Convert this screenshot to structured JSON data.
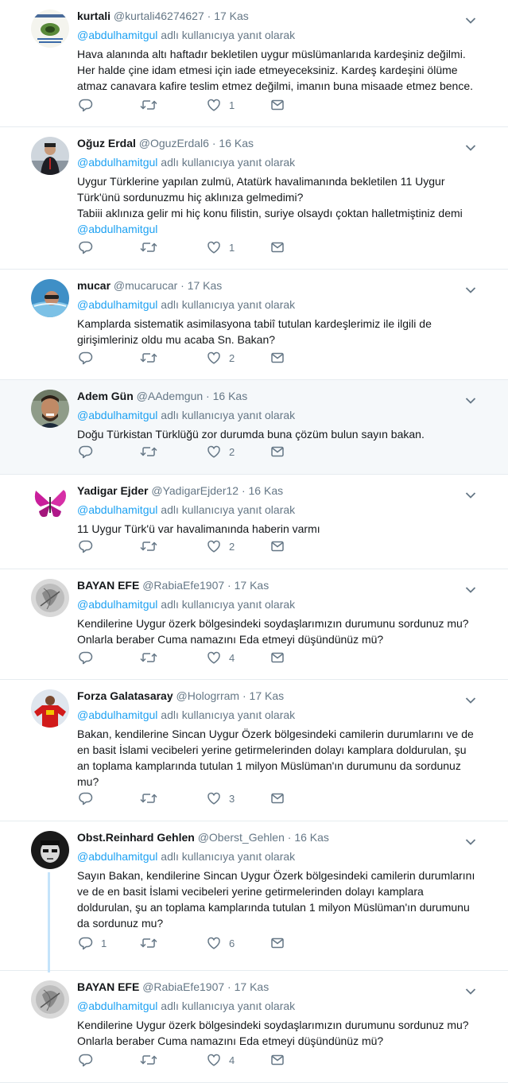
{
  "reply_label": "adlı kullanıcıya yanıt olarak",
  "tweets": [
    {
      "name": "kurtali",
      "handle": "@kurtali46274627",
      "time": "17 Kas",
      "reply_to": "@abdulhamitgul",
      "text": "Hava alanında altı haftadır bekletilen uygur müslümanlarıda kardeşiniz değilmi. Her halde çine idam etmesi için iade etmeyeceksiniz. Kardeş kardeşini ölüme atmaz canavara kafire teslim etmez değilmi, imanın buna misaade etmez bence.",
      "text_mention": "",
      "replies": "",
      "retweets": "",
      "likes": "1"
    },
    {
      "name": "Oğuz Erdal",
      "handle": "@OguzErdal6",
      "time": "16 Kas",
      "reply_to": "@abdulhamitgul",
      "text": "Uygur Türklerine yapılan zulmü, Atatürk havalimanında bekletilen 11 Uygur Türk'ünü sordunuzmu hiç aklınıza gelmedimi?\nTabiii aklınıza gelir mi hiç konu filistin, suriye olsaydı çoktan halletmiştiniz demi",
      "text_mention": "@abdulhamitgul",
      "replies": "",
      "retweets": "",
      "likes": "1"
    },
    {
      "name": "mucar",
      "handle": "@mucarucar",
      "time": "17 Kas",
      "reply_to": "@abdulhamitgul",
      "text": "Kamplarda sistematik asimilasyona tabiî tutulan kardeşlerimiz ile ilgili de girişimleriniz oldu mu acaba Sn. Bakan?",
      "text_mention": "",
      "replies": "",
      "retweets": "",
      "likes": "2"
    },
    {
      "name": "Adem Gün",
      "handle": "@AAdemgun",
      "time": "16 Kas",
      "reply_to": "@abdulhamitgul",
      "text": "Doğu Türkistan Türklüğü zor durumda buna çözüm bulun sayın bakan.",
      "text_mention": "",
      "replies": "",
      "retweets": "",
      "likes": "2"
    },
    {
      "name": "Yadigar Ejder",
      "handle": "@YadigarEjder12",
      "time": "16 Kas",
      "reply_to": "@abdulhamitgul",
      "text": "11 Uygur Türk'ü var havalimanında  haberin varmı",
      "text_mention": "",
      "replies": "",
      "retweets": "",
      "likes": "2"
    },
    {
      "name": "BAYAN EFE",
      "handle": "@RabiaEfe1907",
      "time": "17 Kas",
      "reply_to": "@abdulhamitgul",
      "text": "Kendilerine Uygur özerk bölgesindeki soydaşlarımızın durumunu sordunuz mu?\nOnlarla beraber Cuma namazını Eda etmeyi düşündünüz mü?",
      "text_mention": "",
      "replies": "",
      "retweets": "",
      "likes": "4"
    },
    {
      "name": "Forza Galatasaray",
      "handle": "@Hologrram",
      "time": "17 Kas",
      "reply_to": "@abdulhamitgul",
      "text": "Bakan, kendilerine Sincan Uygur Özerk bölgesindeki camilerin durumlarını ve de en basit İslami vecibeleri yerine getirmelerinden dolayı kamplara doldurulan, şu an toplama kamplarında tutulan 1 milyon Müslüman'ın durumunu da sordunuz mu?",
      "text_mention": "",
      "replies": "",
      "retweets": "",
      "likes": "3"
    },
    {
      "name": "Obst.Reinhard Gehlen",
      "handle": "@Oberst_Gehlen",
      "time": "16 Kas",
      "reply_to": "@abdulhamitgul",
      "text": "Sayın Bakan, kendilerine Sincan Uygur Özerk bölgesindeki camilerin durumlarını ve de en basit İslami vecibeleri yerine getirmelerinden dolayı kamplara doldurulan, şu an toplama kamplarında tutulan 1 milyon Müslüman'ın durumunu da sordunuz mu?",
      "text_mention": "",
      "replies": "1",
      "retweets": "",
      "likes": "6"
    },
    {
      "name": "BAYAN EFE",
      "handle": "@RabiaEfe1907",
      "time": "17 Kas",
      "reply_to": "@abdulhamitgul",
      "text": "Kendilerine Uygur özerk bölgesindeki soydaşlarımızın durumunu sordunuz mu?\nOnlarla beraber Cuma namazını Eda etmeyi düşündünüz mü?",
      "text_mention": "",
      "replies": "",
      "retweets": "",
      "likes": "4"
    }
  ]
}
